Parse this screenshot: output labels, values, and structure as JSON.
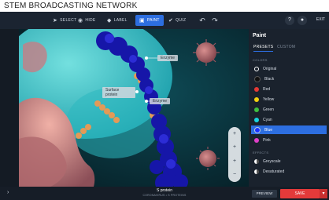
{
  "brand": "STEM BROADCASTING NETWORK",
  "toolbar": {
    "items": [
      {
        "label": "SELECT",
        "icon": "cursor-icon",
        "glyph": "➤"
      },
      {
        "label": "HIDE",
        "icon": "eye-off-icon",
        "glyph": "◉"
      },
      {
        "label": "LABEL",
        "icon": "tag-icon",
        "glyph": "◆"
      },
      {
        "label": "PAINT",
        "icon": "paint-bucket-icon",
        "glyph": "▣",
        "active": true
      },
      {
        "label": "QUIZ",
        "icon": "check-icon",
        "glyph": "✔"
      }
    ],
    "undo_glyph": "↶",
    "redo_glyph": "↷",
    "help_glyph": "?",
    "user_glyph": "●",
    "exit_label": "EXIT"
  },
  "labels": {
    "label_a": "Enzyme",
    "label_b": "Surface\nprotein",
    "label_c": "Enzyme"
  },
  "zoom": {
    "buttons": [
      "+",
      "+",
      "+",
      "−"
    ]
  },
  "panel": {
    "title": "Paint",
    "tabs": [
      "PRESETS",
      "CUSTOM"
    ],
    "colors_heading": "COLORS",
    "colors": [
      {
        "label": "Original",
        "color": "#ffffff",
        "ring": true
      },
      {
        "label": "Black",
        "color": "#111111"
      },
      {
        "label": "Red",
        "color": "#e53935"
      },
      {
        "label": "Yellow",
        "color": "#f2d00f"
      },
      {
        "label": "Green",
        "color": "#3fbf3f"
      },
      {
        "label": "Cyan",
        "color": "#19d3e0"
      },
      {
        "label": "Blue",
        "color": "#1830ff",
        "selected": true
      },
      {
        "label": "Pink",
        "color": "#e040c8"
      }
    ],
    "effects_heading": "EFFECTS",
    "effects": [
      {
        "label": "Greyscale"
      },
      {
        "label": "Desaturated"
      }
    ]
  },
  "bottom": {
    "chevron": "›",
    "title": "S protein",
    "subtitle": "CORONAVIRUS • S PROTEINS",
    "preview_label": "PREVIEW",
    "save_label": "SAVE",
    "save_caret": "▾"
  },
  "accent": "#2d6ee0",
  "save_color": "#e43a3a"
}
